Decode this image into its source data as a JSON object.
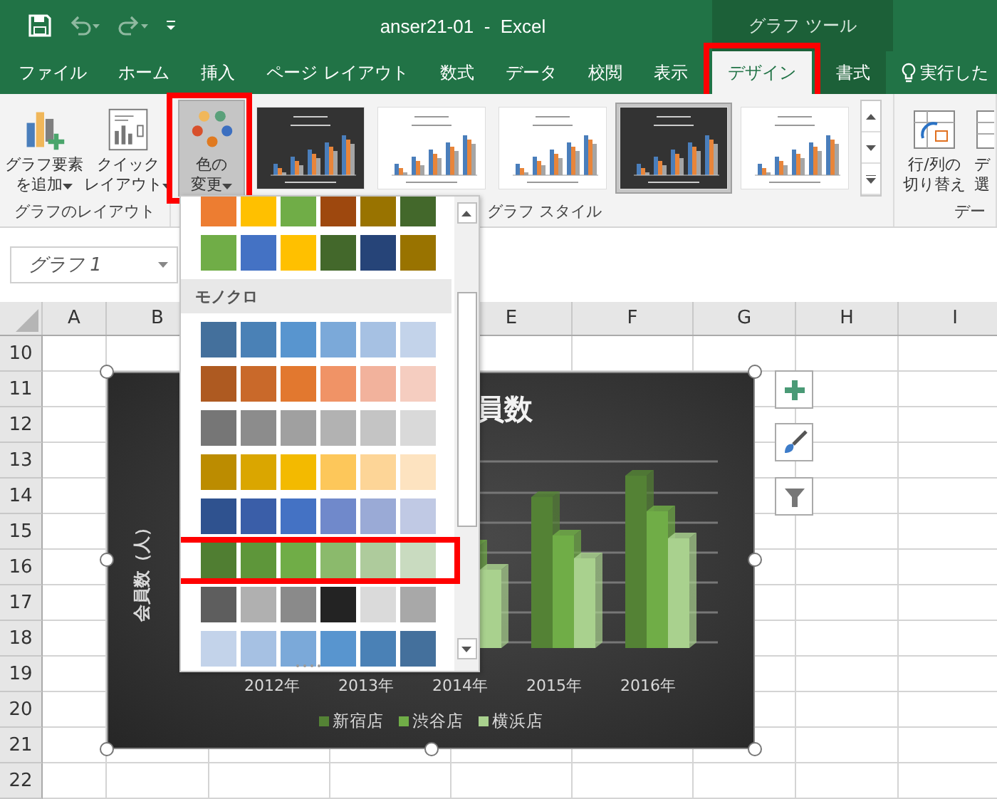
{
  "title_bar": {
    "title": "anser21-01  -  Excel",
    "context_label": "グラフ ツール"
  },
  "tabs": [
    {
      "label": "ファイル",
      "kind": "tab",
      "selected": false,
      "contextual": false,
      "highlighted": false
    },
    {
      "label": "ホーム",
      "kind": "tab",
      "selected": false,
      "contextual": false,
      "highlighted": false
    },
    {
      "label": "挿入",
      "kind": "tab",
      "selected": false,
      "contextual": false,
      "highlighted": false
    },
    {
      "label": "ページ レイアウト",
      "kind": "tab",
      "selected": false,
      "contextual": false,
      "highlighted": false
    },
    {
      "label": "数式",
      "kind": "tab",
      "selected": false,
      "contextual": false,
      "highlighted": false
    },
    {
      "label": "データ",
      "kind": "tab",
      "selected": false,
      "contextual": false,
      "highlighted": false
    },
    {
      "label": "校閲",
      "kind": "tab",
      "selected": false,
      "contextual": false,
      "highlighted": false
    },
    {
      "label": "表示",
      "kind": "tab",
      "selected": false,
      "contextual": false,
      "highlighted": false
    },
    {
      "label": "デザイン",
      "kind": "tab",
      "selected": true,
      "contextual": true,
      "highlighted": true
    },
    {
      "label": "書式",
      "kind": "tab",
      "selected": false,
      "contextual": true,
      "highlighted": false
    },
    {
      "label": "実行した",
      "kind": "tell_me",
      "selected": false,
      "contextual": false,
      "highlighted": false
    }
  ],
  "layout_group": {
    "label": "グラフのレイアウト",
    "buttons": [
      {
        "kind": "add_element",
        "lines": [
          "グラフ要素",
          "を追加"
        ],
        "dropdown": true
      },
      {
        "kind": "quick_layout",
        "lines": [
          "クイック",
          "レイアウト"
        ],
        "dropdown": true
      }
    ]
  },
  "style_group": {
    "label": "グラフ スタイル",
    "color_button": {
      "lines": [
        "色の",
        "変更"
      ],
      "dropdown": true,
      "pressed": true,
      "highlighted": true
    },
    "styles": [
      {
        "kind": "dark",
        "selected": false
      },
      {
        "kind": "light",
        "selected": false
      },
      {
        "kind": "light",
        "selected": false
      },
      {
        "kind": "dark",
        "selected": true
      },
      {
        "kind": "light",
        "selected": false
      }
    ]
  },
  "data_group": {
    "label": "デー",
    "buttons": [
      {
        "kind": "switch",
        "lines": [
          "行/列の",
          "切り替え"
        ]
      },
      {
        "kind": "select",
        "lines": [
          "デ",
          "選"
        ]
      }
    ]
  },
  "name_box": {
    "value": "グラフ 1"
  },
  "sheet": {
    "columns": [
      "A",
      "B",
      "E",
      "F",
      "G",
      "H",
      "I"
    ],
    "rows": [
      "10",
      "11",
      "12",
      "13",
      "14",
      "15",
      "16",
      "17",
      "18",
      "19",
      "20",
      "21",
      "22"
    ]
  },
  "chart": {
    "title": "員数",
    "y_axis_title": "会員数（人）",
    "x_labels": [
      "2012年",
      "2013年",
      "2014年",
      "2015年",
      "2016年"
    ],
    "legend": [
      {
        "label": "新宿店",
        "color": "#548235"
      },
      {
        "label": "渋谷店",
        "color": "#70ad47"
      },
      {
        "label": "横浜店",
        "color": "#a9d18e"
      }
    ]
  },
  "palette": {
    "top_rows": [
      {
        "swatches": [
          {
            "color": "#ed7d31"
          },
          {
            "color": "#ffc000"
          },
          {
            "color": "#70ad47"
          },
          {
            "color": "#9e480e"
          },
          {
            "color": "#997300"
          },
          {
            "color": "#43682b"
          }
        ]
      },
      {
        "swatches": [
          {
            "color": "#70ad47"
          },
          {
            "color": "#4472c4"
          },
          {
            "color": "#ffc000"
          },
          {
            "color": "#43682b"
          },
          {
            "color": "#264478"
          },
          {
            "color": "#997300"
          }
        ]
      }
    ],
    "section_label": "モノクロ",
    "rows": [
      {
        "swatches": [
          {
            "color": "#44709c"
          },
          {
            "color": "#4a81b6"
          },
          {
            "color": "#5895cf"
          },
          {
            "color": "#7ba9d9"
          },
          {
            "color": "#a6c1e3"
          },
          {
            "color": "#c3d3ea"
          }
        ],
        "highlighted": false
      },
      {
        "swatches": [
          {
            "color": "#ae5a21"
          },
          {
            "color": "#c9692a"
          },
          {
            "color": "#e2782f"
          },
          {
            "color": "#f09366"
          },
          {
            "color": "#f2b29c"
          },
          {
            "color": "#f5cdc0"
          }
        ],
        "highlighted": false
      },
      {
        "swatches": [
          {
            "color": "#767676"
          },
          {
            "color": "#8c8c8c"
          },
          {
            "color": "#a0a0a0"
          },
          {
            "color": "#b2b2b2"
          },
          {
            "color": "#c4c4c4"
          },
          {
            "color": "#d9d9d9"
          }
        ],
        "highlighted": false
      },
      {
        "swatches": [
          {
            "color": "#bc8c00"
          },
          {
            "color": "#daa600"
          },
          {
            "color": "#f3ba00"
          },
          {
            "color": "#fdc75a"
          },
          {
            "color": "#fdd597"
          },
          {
            "color": "#fde3c0"
          }
        ],
        "highlighted": false
      },
      {
        "swatches": [
          {
            "color": "#2f528f"
          },
          {
            "color": "#3a5ea8"
          },
          {
            "color": "#4472c4"
          },
          {
            "color": "#7089cb"
          },
          {
            "color": "#9aaad6"
          },
          {
            "color": "#c0c9e4"
          }
        ],
        "highlighted": false
      },
      {
        "swatches": [
          {
            "color": "#507e32"
          },
          {
            "color": "#5e963a"
          },
          {
            "color": "#70ad47"
          },
          {
            "color": "#8bba6c"
          },
          {
            "color": "#aecb9c"
          },
          {
            "color": "#c9dbc0"
          }
        ],
        "highlighted": true
      },
      {
        "swatches": [
          {
            "color": "#5e5e5e"
          },
          {
            "color": "#b0b0b0"
          },
          {
            "color": "#8a8a8a"
          },
          {
            "color": "#232323"
          },
          {
            "color": "#dadada"
          },
          {
            "color": "#a8a8a8"
          }
        ],
        "highlighted": false
      },
      {
        "swatches": [
          {
            "color": "#c3d3ea"
          },
          {
            "color": "#a6c1e3"
          },
          {
            "color": "#7ba9d9"
          },
          {
            "color": "#5895cf"
          },
          {
            "color": "#4a81b6"
          },
          {
            "color": "#44709c"
          }
        ],
        "highlighted": false
      }
    ]
  }
}
